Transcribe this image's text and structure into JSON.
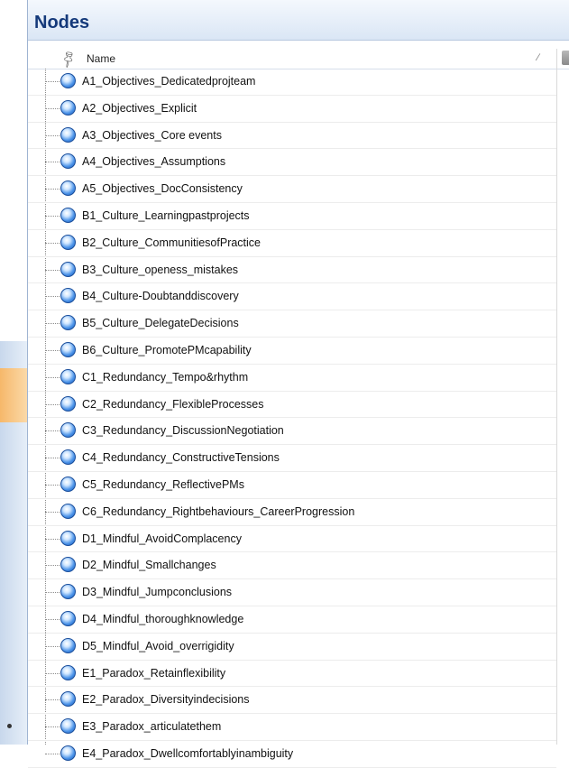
{
  "panel": {
    "title": "Nodes"
  },
  "columns": {
    "name_label": "Name"
  },
  "nodes": [
    {
      "label": "A1_Objectives_Dedicatedprojteam"
    },
    {
      "label": "A2_Objectives_Explicit"
    },
    {
      "label": "A3_Objectives_Core events"
    },
    {
      "label": "A4_Objectives_Assumptions"
    },
    {
      "label": "A5_Objectives_DocConsistency"
    },
    {
      "label": "B1_Culture_Learningpastprojects"
    },
    {
      "label": "B2_Culture_CommunitiesofPractice"
    },
    {
      "label": "B3_Culture_openess_mistakes"
    },
    {
      "label": "B4_Culture-Doubtanddiscovery"
    },
    {
      "label": "B5_Culture_DelegateDecisions"
    },
    {
      "label": "B6_Culture_PromotePMcapability"
    },
    {
      "label": "C1_Redundancy_Tempo&rhythm"
    },
    {
      "label": "C2_Redundancy_FlexibleProcesses"
    },
    {
      "label": "C3_Redundancy_DiscussionNegotiation"
    },
    {
      "label": "C4_Redundancy_ConstructiveTensions"
    },
    {
      "label": "C5_Redundancy_ReflectivePMs"
    },
    {
      "label": "C6_Redundancy_Rightbehaviours_CareerProgression"
    },
    {
      "label": "D1_Mindful_AvoidComplacency"
    },
    {
      "label": "D2_Mindful_Smallchanges"
    },
    {
      "label": "D3_Mindful_Jumpconclusions"
    },
    {
      "label": "D4_Mindful_thoroughknowledge"
    },
    {
      "label": "D5_Mindful_Avoid_overrigidity"
    },
    {
      "label": "E1_Paradox_Retainflexibility"
    },
    {
      "label": "E2_Paradox_Diversityindecisions"
    },
    {
      "label": "E3_Paradox_articulatethem"
    },
    {
      "label": "E4_Paradox_Dwellcomfortablyinambiguity"
    }
  ],
  "icons": {
    "node": "node-circle-icon",
    "pin": "pin-icon",
    "sort": "sort-icon"
  },
  "colors": {
    "title": "#14397a",
    "node_icon": "#4a92e8",
    "header_bg": "#dae6f5"
  }
}
